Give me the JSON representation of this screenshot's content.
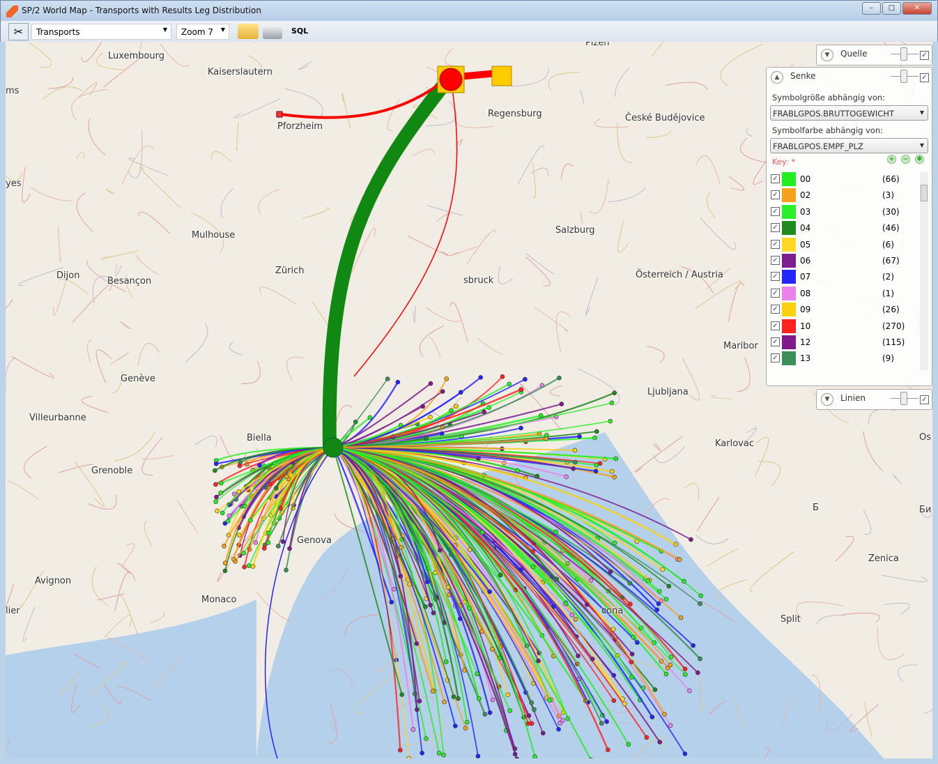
{
  "window": {
    "title": "SP/2 World Map - Transports with Results Leg Distribution",
    "minimize": "–",
    "maximize": "□",
    "close": "✕"
  },
  "toolbar": {
    "tools_icon": "tools-icon",
    "layer_select": "Transports",
    "zoom_select": "Zoom 7",
    "open_icon": "folder-open-icon",
    "print_icon": "printer-icon",
    "sql_label": "SQL"
  },
  "cities": [
    "Luxembourg",
    "Kaiserslautern",
    "Plzen",
    "Regensburg",
    "České Budějovice",
    "Pforzheim",
    "Mulhouse",
    "Dijon",
    "Besançon",
    "Zürich",
    "Salzburg",
    "sbruck",
    "Österreich / Austria",
    "Maribor",
    "Genève",
    "Ljubljana",
    "Villeurbanne",
    "Biella",
    "Grenoble",
    "Karlovac",
    "Genova",
    "Avignon",
    "Monaco",
    "Zenica",
    "Split",
    "cona",
    "Б",
    "Би",
    "Os",
    "yes",
    "ms",
    "lier"
  ],
  "panels": {
    "quelle": {
      "title": "Quelle",
      "checked": true
    },
    "senke": {
      "title": "Senke",
      "checked": true,
      "size_label": "Symbolgröße abhängig von:",
      "size_value": "FRABLGPOS.BRUTTOGEWICHT",
      "color_label": "Symbolfarbe abhängig von:",
      "color_value": "FRABLGPOS.EMPF_PLZ",
      "key_label": "Key: *",
      "legend": [
        {
          "code": "00",
          "count": "(66)",
          "color": "#22ee22",
          "checked": true
        },
        {
          "code": "02",
          "count": "(3)",
          "color": "#f5a21c",
          "checked": true
        },
        {
          "code": "03",
          "count": "(30)",
          "color": "#2bef2b",
          "checked": true
        },
        {
          "code": "04",
          "count": "(46)",
          "color": "#1f8a1f",
          "checked": true
        },
        {
          "code": "05",
          "count": "(6)",
          "color": "#ffd823",
          "checked": true
        },
        {
          "code": "06",
          "count": "(67)",
          "color": "#7d1f8f",
          "checked": true
        },
        {
          "code": "07",
          "count": "(2)",
          "color": "#2424ff",
          "checked": true
        },
        {
          "code": "08",
          "count": "(1)",
          "color": "#ea82ea",
          "checked": true
        },
        {
          "code": "09",
          "count": "(26)",
          "color": "#f9d10d",
          "checked": true
        },
        {
          "code": "10",
          "count": "(270)",
          "color": "#ff2222",
          "checked": true
        },
        {
          "code": "12",
          "count": "(115)",
          "color": "#7e1a8a",
          "checked": true
        },
        {
          "code": "13",
          "count": "(9)",
          "color": "#3d8f5a",
          "checked": true
        }
      ]
    },
    "linien": {
      "title": "Linien",
      "checked": true
    }
  },
  "colors": {
    "main_flow": "#118811",
    "source": "#ff0000",
    "sink_alt": "#ffcc00"
  }
}
